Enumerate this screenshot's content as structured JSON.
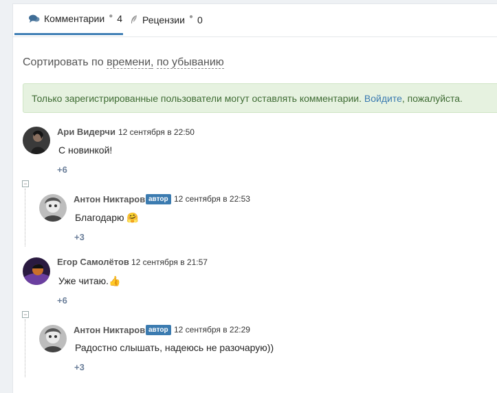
{
  "tabs": [
    {
      "label": "Комментарии",
      "count": "4",
      "icon": "comments-icon"
    },
    {
      "label": "Рецензии",
      "count": "0",
      "icon": "feather-icon"
    }
  ],
  "sort": {
    "prefix": "Сортировать по",
    "option1": "времени",
    "sep": ",",
    "option2": "по убыванию"
  },
  "notice": {
    "text": "Только зарегистрированные пользователи могут оставлять комментарии.",
    "link": "Войдите",
    "suffix": ", пожалуйста."
  },
  "comments": [
    {
      "author": "Ари Видерчи",
      "time": "12 сентября в 22:50",
      "text": "С новинкой!",
      "votes": "+6",
      "badge": "",
      "emoji": ""
    },
    {
      "author": "Антон Никтаров",
      "badge": "автор",
      "time": "12 сентября в 22:53",
      "text": "Благодарю",
      "emoji": "🤗",
      "votes": "+3"
    },
    {
      "author": "Егор Самолётов",
      "time": "12 сентября в 21:57",
      "text": "Уже читаю.",
      "emoji": "👍",
      "votes": "+6",
      "badge": ""
    },
    {
      "author": "Антон Никтаров",
      "badge": "автор",
      "time": "12 сентября в 22:29",
      "text": "Радостно слышать, надеюсь не разочарую))",
      "emoji": "",
      "votes": "+3"
    }
  ],
  "colors": {
    "accent": "#3f7fb5",
    "badge": "#3b7bb0",
    "notice_bg": "#e6f2e0",
    "votes": "#6a7e99"
  }
}
